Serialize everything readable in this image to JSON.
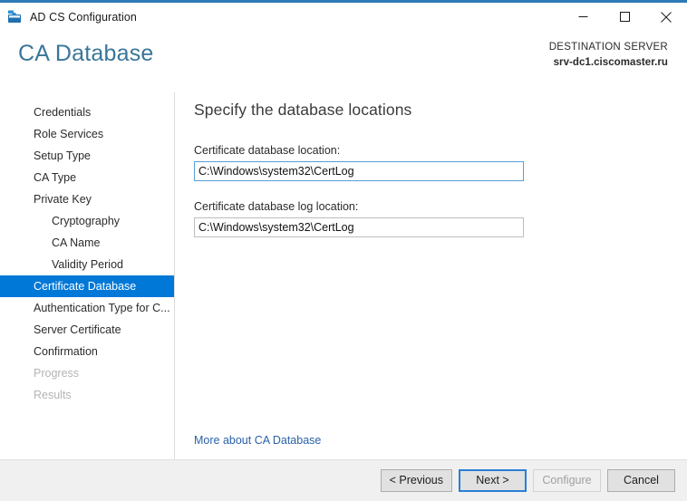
{
  "window": {
    "title": "AD CS Configuration",
    "icon": "server-manager-icon",
    "accent_color": "#2d7ab5",
    "controls": {
      "minimize": "minimize-icon",
      "maximize": "maximize-icon",
      "close": "close-icon"
    }
  },
  "header": {
    "page_title": "CA Database",
    "page_title_color": "#3a7699",
    "destination_label": "DESTINATION SERVER",
    "destination_value": "srv-dc1.ciscomaster.ru"
  },
  "navigation": {
    "selected_color": "#0078d7",
    "items": [
      {
        "label": "Credentials",
        "level": 0,
        "state": "normal"
      },
      {
        "label": "Role Services",
        "level": 0,
        "state": "normal"
      },
      {
        "label": "Setup Type",
        "level": 0,
        "state": "normal"
      },
      {
        "label": "CA Type",
        "level": 0,
        "state": "normal"
      },
      {
        "label": "Private Key",
        "level": 0,
        "state": "normal"
      },
      {
        "label": "Cryptography",
        "level": 1,
        "state": "normal"
      },
      {
        "label": "CA Name",
        "level": 1,
        "state": "normal"
      },
      {
        "label": "Validity Period",
        "level": 1,
        "state": "normal"
      },
      {
        "label": "Certificate Database",
        "level": 0,
        "state": "selected"
      },
      {
        "label": "Authentication Type for C...",
        "level": 0,
        "state": "normal"
      },
      {
        "label": "Server Certificate",
        "level": 0,
        "state": "normal"
      },
      {
        "label": "Confirmation",
        "level": 0,
        "state": "normal"
      },
      {
        "label": "Progress",
        "level": 0,
        "state": "disabled"
      },
      {
        "label": "Results",
        "level": 0,
        "state": "disabled"
      }
    ]
  },
  "content": {
    "heading": "Specify the database locations",
    "fields": [
      {
        "label": "Certificate database location:",
        "value": "C:\\Windows\\system32\\CertLog",
        "focused": true
      },
      {
        "label": "Certificate database log location:",
        "value": "C:\\Windows\\system32\\CertLog",
        "focused": false
      }
    ],
    "help_link": "More about CA Database",
    "help_link_color": "#2a62a8"
  },
  "footer": {
    "buttons": [
      {
        "label": "< Previous",
        "state": "normal"
      },
      {
        "label": "Next >",
        "state": "default"
      },
      {
        "label": "Configure",
        "state": "disabled"
      },
      {
        "label": "Cancel",
        "state": "normal"
      }
    ]
  }
}
